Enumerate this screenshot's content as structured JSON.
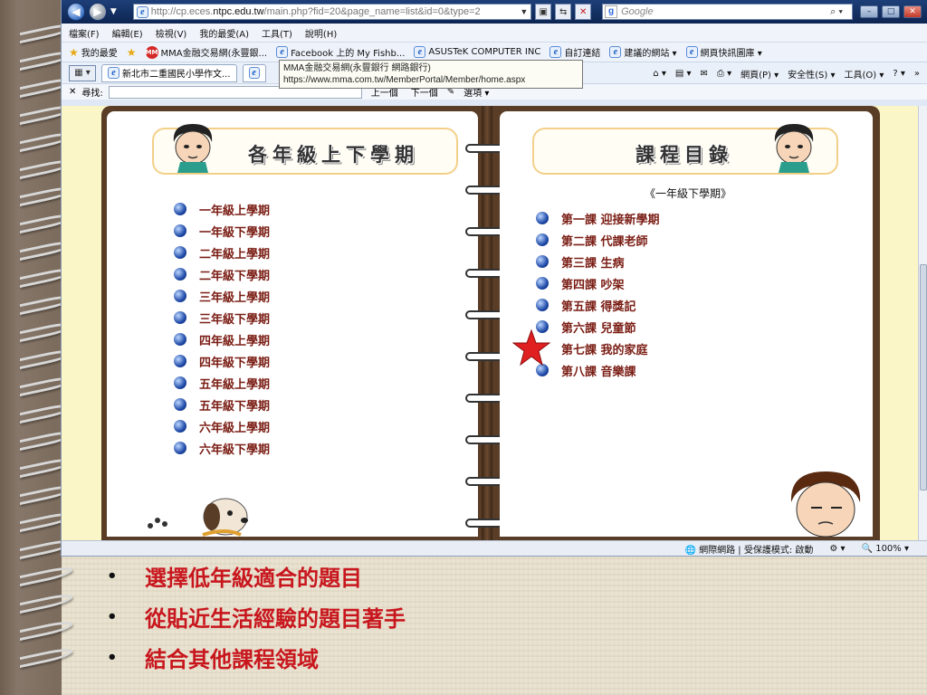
{
  "browser": {
    "url_prefix": "http://cp.eces.",
    "url_domain": "ntpc.edu.tw",
    "url_rest": "/main.php?fid=20&page_name=list&id=0&type=2",
    "search_placeholder": "Google",
    "menu": [
      "檔案(F)",
      "編輯(E)",
      "檢視(V)",
      "我的最愛(A)",
      "工具(T)",
      "說明(H)"
    ],
    "favorites_label": "我的最愛",
    "favorites": [
      "MMA金融交易網(永豐銀...",
      "Facebook 上的 My Fishb...",
      "ASUSTeK COMPUTER INC",
      "自訂連結",
      "建議的網站 ▾",
      "網頁快訊圖庫 ▾"
    ],
    "tab_label": "新北市二重國民小學作文...",
    "tooltip_line1": "MMA金融交易網(永豐銀行 網路銀行)",
    "tooltip_line2": "https://www.mma.com.tw/MemberPortal/Member/home.aspx",
    "cmd": [
      "網頁(P) ▾",
      "安全性(S) ▾",
      "工具(O) ▾"
    ],
    "find_label": "尋找:",
    "find_prev": "上一個",
    "find_next": "下一個",
    "find_options": "選項 ▾",
    "status_zone": "網際網路 | 受保護模式: 啟動",
    "zoom": "100%"
  },
  "left_page": {
    "title": "各年級上下學期",
    "items": [
      "一年級上學期",
      "一年級下學期",
      "二年級上學期",
      "二年級下學期",
      "三年級上學期",
      "三年級下學期",
      "四年級上學期",
      "四年級下學期",
      "五年級上學期",
      "五年級下學期",
      "六年級上學期",
      "六年級下學期"
    ]
  },
  "right_page": {
    "title": "課程目錄",
    "subtitle": "《一年級下學期》",
    "lessons": [
      "第一課 迎接新學期",
      "第二課 代課老師",
      "第三課 生病",
      "第四課 吵架",
      "第五課 得獎記",
      "第六課 兒童節",
      "第七課 我的家庭",
      "第八課 音樂課"
    ],
    "highlight_index": 6
  },
  "slide_bullets": [
    "選擇低年級適合的題目",
    "從貼近生活經驗的題目著手",
    "結合其他課程領域"
  ],
  "colors": {
    "bullet_text": "#c8161d",
    "list_text": "#7a1d14",
    "star": "#e02020"
  }
}
